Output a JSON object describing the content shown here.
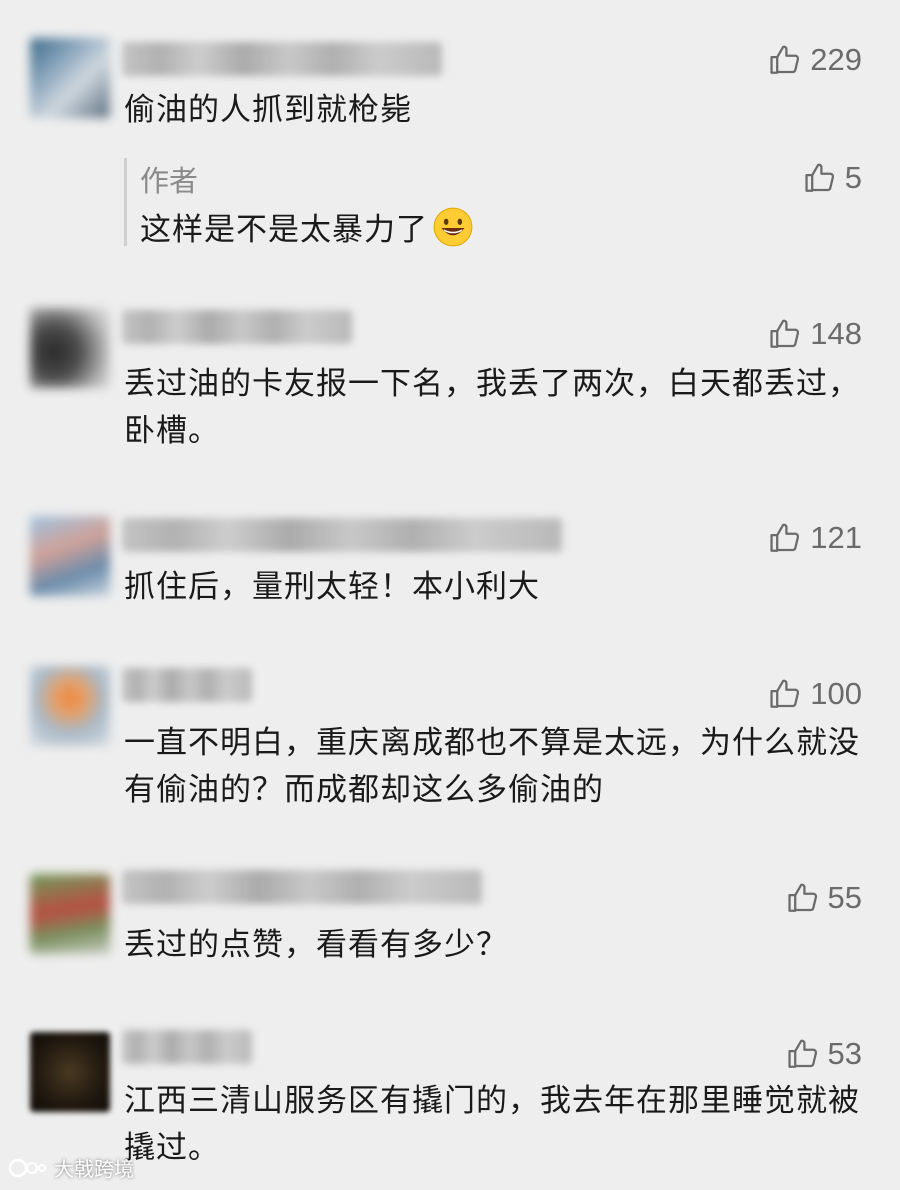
{
  "comments": [
    {
      "likes": "229",
      "text": "偷油的人抓到就枪毙"
    },
    {
      "likes": "148",
      "text": "丢过油的卡友报一下名，我丢了两次，白天都丢过，卧槽。"
    },
    {
      "likes": "121",
      "text": "抓住后，量刑太轻！本小利大"
    },
    {
      "likes": "100",
      "text": "一直不明白，重庆离成都也不算是太远，为什么就没有偷油的？而成都却这么多偷油的"
    },
    {
      "likes": "55",
      "text": "丢过的点赞，看看有多少？"
    },
    {
      "likes": "53",
      "text": "江西三清山服务区有撬门的，我去年在那里睡觉就被撬过。"
    }
  ],
  "reply": {
    "author": "作者",
    "likes": "5",
    "text": "这样是不是太暴力了"
  },
  "watermark": "大戟跨境",
  "colors": {
    "background": "#eeeeee",
    "like_gray": "#6b6b6b",
    "reply_bar": "#cfcfcf"
  },
  "icons": {
    "like": "thumbs-up-icon",
    "emoji": "grinning-face-icon"
  }
}
